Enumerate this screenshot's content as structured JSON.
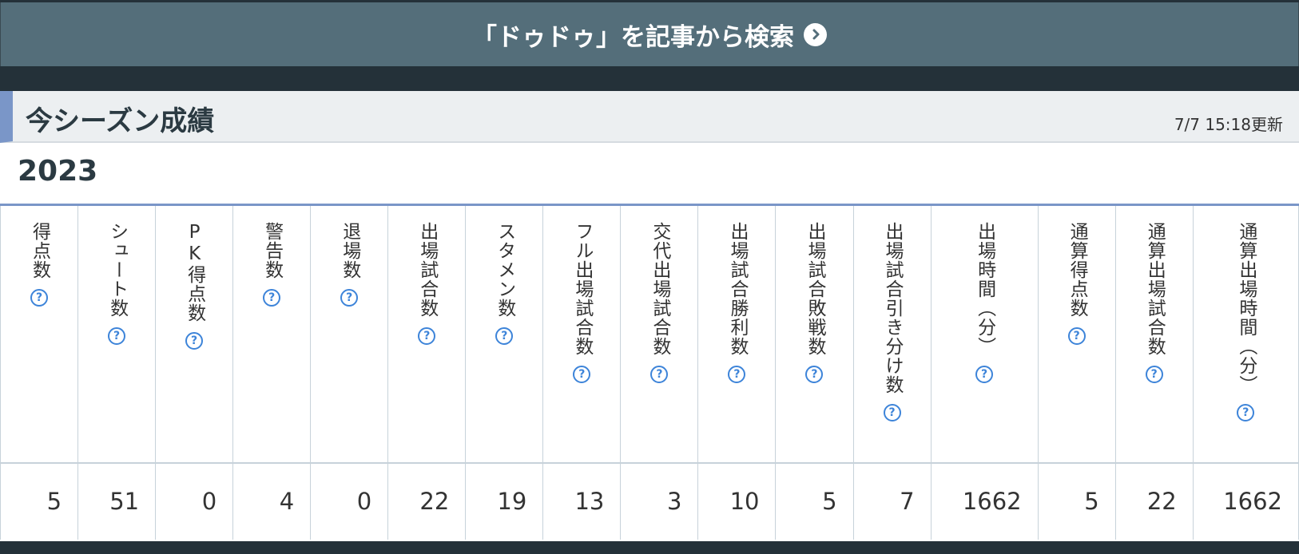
{
  "search": {
    "label": "「ドゥドゥ」を記事から検索",
    "icon": "chevron-right-circle-icon"
  },
  "section": {
    "title": "今シーズン成績",
    "updated": "7/7 15:18更新",
    "accent_color": "#7a96c8"
  },
  "season": "2023",
  "stats": {
    "help_icon": "question-circle-icon",
    "columns": [
      {
        "label": "得点数",
        "value": "5"
      },
      {
        "label": "シュート数",
        "value": "51"
      },
      {
        "label": "PK得点数",
        "value": "0"
      },
      {
        "label": "警告数",
        "value": "4"
      },
      {
        "label": "退場数",
        "value": "0"
      },
      {
        "label": "出場試合数",
        "value": "22"
      },
      {
        "label": "スタメン数",
        "value": "19"
      },
      {
        "label": "フル出場試合数",
        "value": "13"
      },
      {
        "label": "交代出場試合数",
        "value": "3"
      },
      {
        "label": "出場試合勝利数",
        "value": "10"
      },
      {
        "label": "出場試合敗戦数",
        "value": "5"
      },
      {
        "label": "出場試合引き分け数",
        "value": "7"
      },
      {
        "label": "出場時間（分）",
        "value": "1662"
      },
      {
        "label": "通算得点数",
        "value": "5"
      },
      {
        "label": "通算出場試合数",
        "value": "22"
      },
      {
        "label": "通算出場時間（分）",
        "value": "1662"
      }
    ]
  }
}
